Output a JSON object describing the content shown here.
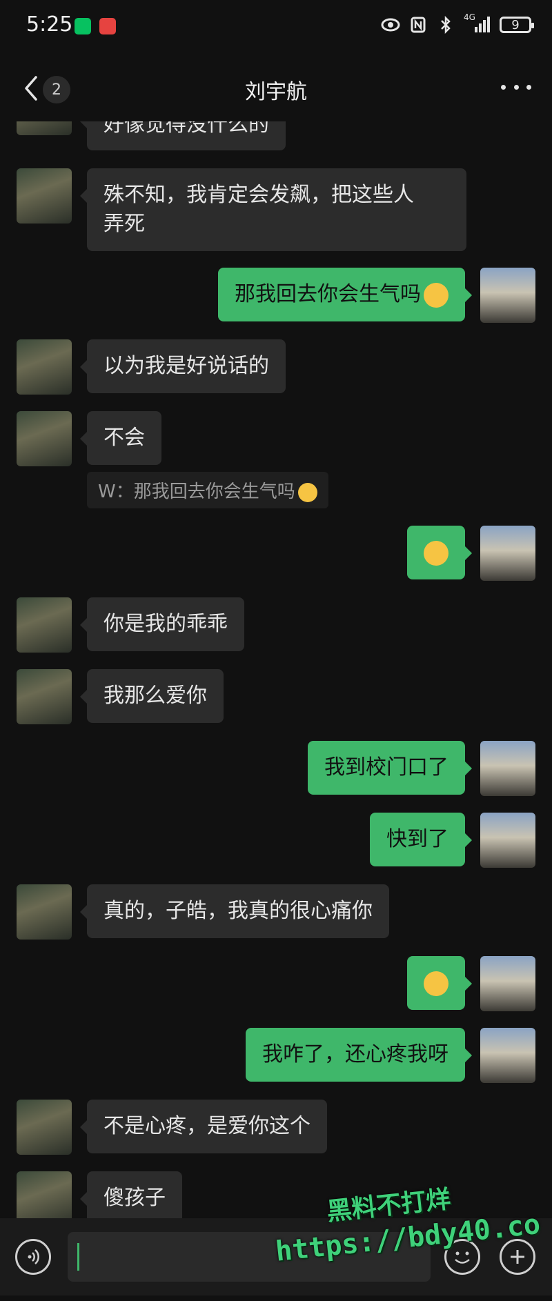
{
  "status_bar": {
    "time": "5:25",
    "network": "4G",
    "battery_level": "9",
    "icons": [
      "wechat-icon",
      "alert-app-icon",
      "eye-icon",
      "nfc-icon",
      "bluetooth-icon",
      "signal-icon",
      "battery-icon"
    ]
  },
  "nav": {
    "unread_count": "2",
    "contact_name": "刘宇航",
    "icons": [
      "back-chevron-icon",
      "more-icon"
    ]
  },
  "messages": [
    {
      "side": "left",
      "text": "好像觉得没什么的"
    },
    {
      "side": "left",
      "text": "殊不知，我肯定会发飙，把这些人弄死",
      "line1": "殊不知，我肯定会发飙，把这些人",
      "line2": "弄死"
    },
    {
      "side": "right",
      "text": "那我回去你会生气吗",
      "emoji": "smile-face"
    },
    {
      "side": "left",
      "text": "以为我是好说话的"
    },
    {
      "side": "left",
      "text": "不会",
      "quote": "W：那我回去你会生气吗"
    },
    {
      "side": "right",
      "text": "",
      "emoji": "kissing-face"
    },
    {
      "side": "left",
      "text": "你是我的乖乖"
    },
    {
      "side": "left",
      "text": "我那么爱你"
    },
    {
      "side": "right",
      "text": "我到校门口了"
    },
    {
      "side": "right",
      "text": "快到了"
    },
    {
      "side": "left",
      "text": "真的，子皓，我真的很心痛你"
    },
    {
      "side": "right",
      "text": "",
      "emoji": "smile-face"
    },
    {
      "side": "right",
      "text": "我咋了，还心疼我呀"
    },
    {
      "side": "left",
      "text": "不是心疼，是爱你这个"
    },
    {
      "side": "left",
      "text": "傻孩子"
    }
  ],
  "input_bar": {
    "icons": [
      "voice-icon",
      "emoji-icon",
      "plus-icon"
    ]
  },
  "watermark": {
    "line1": "黑料不打烊",
    "line2": "https://bdy40.co"
  },
  "colors": {
    "background": "#111111",
    "bubble_left": "#2c2c2c",
    "bubble_right": "#3fb76a",
    "watermark": "#3fd17a"
  }
}
